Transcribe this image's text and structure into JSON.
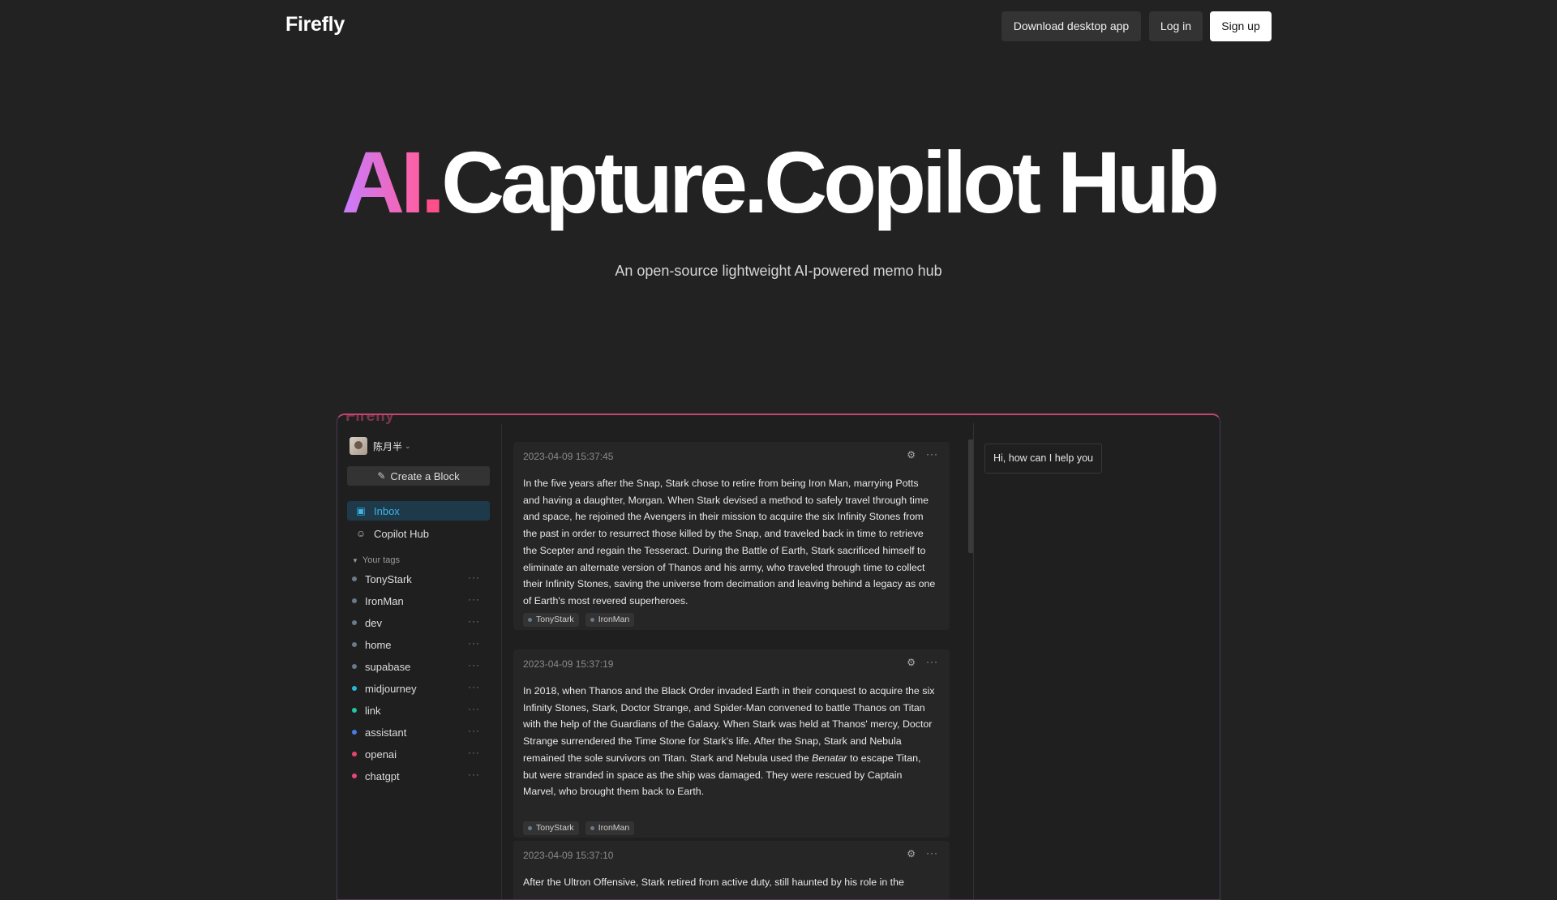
{
  "brand": {
    "logo": "Firefly"
  },
  "nav": {
    "download": "Download desktop app",
    "login": "Log in",
    "signup": "Sign up"
  },
  "hero": {
    "title_ai": "AI",
    "title_dot": ".",
    "title_rest": "Capture.Copilot Hub",
    "subtitle": "An open-source lightweight AI-powered memo hub"
  },
  "preview": {
    "ghost_title": "Firefly",
    "user": {
      "name": "陈月半",
      "caret": "⌄"
    },
    "create_button": "Create a Block",
    "nav_items": [
      {
        "label": "Inbox",
        "icon": "inbox-icon"
      },
      {
        "label": "Copilot Hub",
        "icon": "bot-icon"
      }
    ],
    "tags_header": "Your tags",
    "tags": [
      {
        "label": "TonyStark",
        "color": "#6a7a8a"
      },
      {
        "label": "IronMan",
        "color": "#6a7a8a"
      },
      {
        "label": "dev",
        "color": "#6a7a8a"
      },
      {
        "label": "home",
        "color": "#6a7a8a"
      },
      {
        "label": "supabase",
        "color": "#6a7a8a"
      },
      {
        "label": "midjourney",
        "color": "#25b8d8"
      },
      {
        "label": "link",
        "color": "#1fc7a6"
      },
      {
        "label": "assistant",
        "color": "#4a7ae8"
      },
      {
        "label": "openai",
        "color": "#e8456e"
      },
      {
        "label": "chatgpt",
        "color": "#e8457e"
      }
    ],
    "cards": [
      {
        "timestamp": "2023-04-09 15:37:45",
        "body": "In the five years after the Snap, Stark chose to retire from being Iron Man, marrying Potts and having a daughter, Morgan. When Stark devised a method to safely travel through time and space, he rejoined the Avengers in their mission to acquire the six Infinity Stones from the past in order to resurrect those killed by the Snap, and traveled back in time to retrieve the Scepter and regain the Tesseract. During the Battle of Earth, Stark sacrificed himself to eliminate an alternate version of Thanos and his army, who traveled through time to collect their Infinity Stones, saving the universe from decimation and leaving behind a legacy as one of Earth's most revered superheroes.",
        "tags": [
          "TonyStark",
          "IronMan"
        ]
      },
      {
        "timestamp": "2023-04-09 15:37:19",
        "body_before": "In 2018, when Thanos and the Black Order invaded Earth in their conquest to acquire the six Infinity Stones, Stark, Doctor Strange, and Spider-Man convened to battle Thanos on Titan with the help of the Guardians of the Galaxy. When Stark was held at Thanos' mercy, Doctor Strange surrendered the Time Stone for Stark's life. After the Snap, Stark and Nebula remained the sole survivors on Titan. Stark and Nebula used the ",
        "body_italic": "Benatar",
        "body_after": " to escape Titan, but were stranded in space as the ship was damaged. They were rescued by Captain Marvel, who brought them back to Earth.",
        "tags": [
          "TonyStark",
          "IronMan"
        ]
      },
      {
        "timestamp": "2023-04-09 15:37:10",
        "body": "After the Ultron Offensive, Stark retired from active duty, still haunted by his role in the"
      }
    ],
    "copilot": {
      "greeting": "Hi, how can I help you"
    }
  }
}
